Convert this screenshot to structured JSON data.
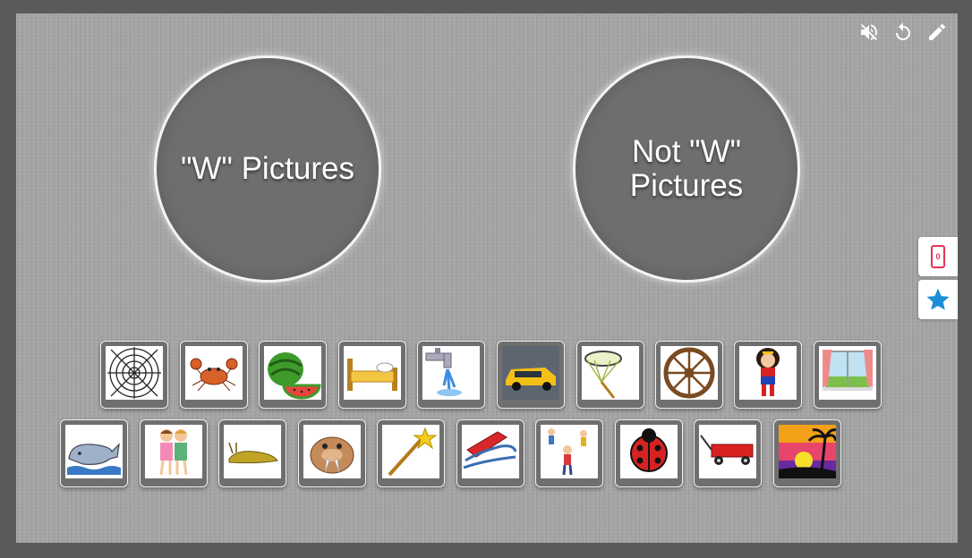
{
  "bins": [
    {
      "id": "w",
      "label": "\"W\" Pictures"
    },
    {
      "id": "not-w",
      "label": "Not \"W\" Pictures"
    }
  ],
  "toolbar": {
    "mute_icon": "volume-off-icon",
    "restart_icon": "restart-icon",
    "edit_icon": "pencil-icon"
  },
  "side_panel": {
    "device_count": "0",
    "device_icon": "phone-icon",
    "favorite_icon": "star-icon"
  },
  "colors": {
    "stage": "#a3a3a3",
    "frame": "#5a5a5a",
    "card": "#6f6f6f",
    "phone_accent": "#e53358",
    "star_accent": "#1a8ed6"
  },
  "cards_row1": [
    "spider web",
    "crab",
    "watermelon",
    "bed",
    "water faucet",
    "taxi",
    "net",
    "wagon wheel",
    "wonder woman",
    "window"
  ],
  "cards_row2": [
    "whale",
    "hugging girls",
    "slug",
    "walrus",
    "magic wand",
    "sled",
    "children",
    "ladybug",
    "red wagon",
    "sunset"
  ]
}
